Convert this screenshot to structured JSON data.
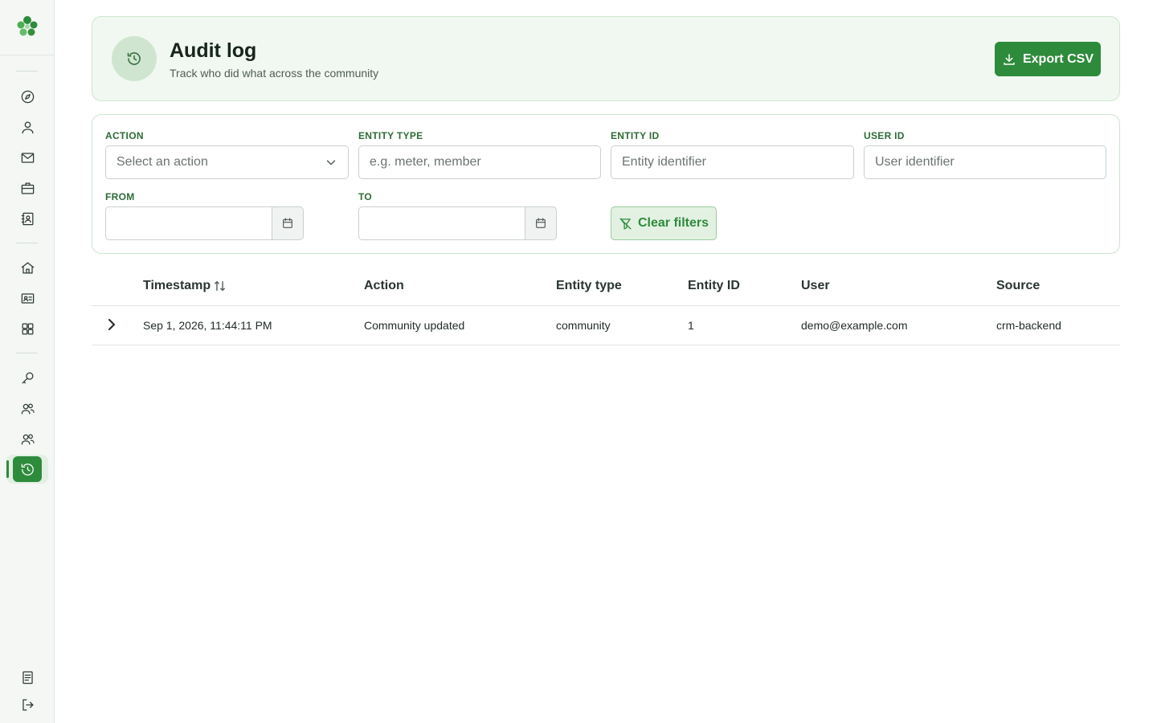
{
  "colors": {
    "accent": "#2e8b3c",
    "accent_light": "#e3f1e3",
    "header_bg": "#f1f8f1",
    "sidebar_bg": "#f4f7f4"
  },
  "sidebar": {
    "logo_icon": "clover-logo-icon",
    "items": [
      {
        "icon": "compass-icon",
        "active": false
      },
      {
        "icon": "user-icon",
        "active": false
      },
      {
        "icon": "mail-icon",
        "active": false
      },
      {
        "icon": "briefcase-icon",
        "active": false
      },
      {
        "icon": "contact-book-icon",
        "active": false
      },
      {
        "icon": "home-icon",
        "active": false
      },
      {
        "icon": "id-card-icon",
        "active": false
      },
      {
        "icon": "grid-icon",
        "active": false
      },
      {
        "icon": "key-icon",
        "active": false
      },
      {
        "icon": "users-icon",
        "active": false
      },
      {
        "icon": "team-icon",
        "active": false
      },
      {
        "icon": "history-icon",
        "active": true
      }
    ],
    "bottom_items": [
      {
        "icon": "document-icon"
      },
      {
        "icon": "logout-icon"
      }
    ]
  },
  "header": {
    "icon": "history-icon",
    "title": "Audit log",
    "subtitle": "Track who did what across the community",
    "export_label": "Export CSV"
  },
  "filters": {
    "action": {
      "label": "ACTION",
      "placeholder": "Select an action"
    },
    "entity_type": {
      "label": "ENTITY TYPE",
      "placeholder": "e.g. meter, member"
    },
    "entity_id": {
      "label": "ENTITY ID",
      "placeholder": "Entity identifier"
    },
    "user_id": {
      "label": "USER ID",
      "placeholder": "User identifier"
    },
    "from": {
      "label": "FROM",
      "value": ""
    },
    "to": {
      "label": "TO",
      "value": ""
    },
    "clear_label": "Clear filters"
  },
  "table": {
    "columns": [
      "Timestamp",
      "Action",
      "Entity type",
      "Entity ID",
      "User",
      "Source"
    ],
    "rows": [
      {
        "timestamp": "Sep 1, 2026, 11:44:11 PM",
        "action": "Community updated",
        "entity_type": "community",
        "entity_id": "1",
        "user": "demo@example.com",
        "source": "crm-backend"
      }
    ]
  }
}
